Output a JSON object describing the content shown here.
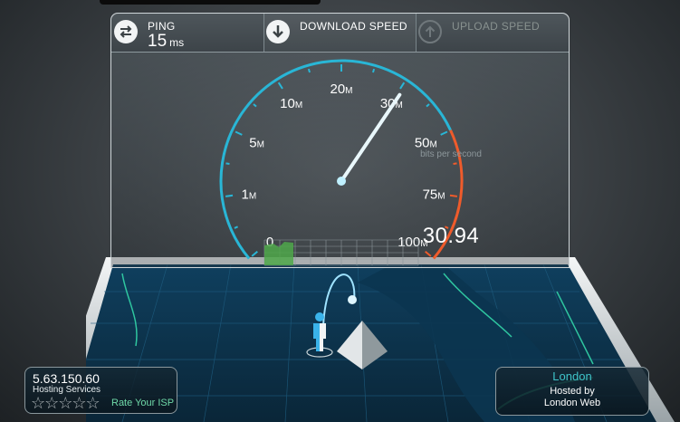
{
  "header": {
    "ping_label": "PING",
    "ping_value": "15",
    "ping_unit": "ms",
    "download_label": "DOWNLOAD SPEED",
    "upload_label": "UPLOAD SPEED"
  },
  "gauge": {
    "ticks": [
      {
        "label": "0",
        "unit": ""
      },
      {
        "label": "1",
        "unit": "M"
      },
      {
        "label": "5",
        "unit": "M"
      },
      {
        "label": "10",
        "unit": "M"
      },
      {
        "label": "20",
        "unit": "M"
      },
      {
        "label": "30",
        "unit": "M"
      },
      {
        "label": "50",
        "unit": "M"
      },
      {
        "label": "75",
        "unit": "M"
      },
      {
        "label": "100",
        "unit": "M"
      }
    ],
    "center_label": "bits per second",
    "speed_value": "30.94",
    "needle_value_mbps": 30.94,
    "accent_color": "#29b6d6",
    "high_color": "#ef5b2b"
  },
  "client": {
    "ip": "5.63.150.60",
    "isp": "Hosting Services",
    "rating_stars": 5,
    "rate_link": "Rate Your ISP"
  },
  "server": {
    "city": "London",
    "hosted_by": "Hosted by",
    "host_name": "London Web"
  },
  "icons": {
    "ping": "swap-arrows-icon",
    "download": "download-arrow-icon",
    "upload": "upload-arrow-icon",
    "user": "person-icon",
    "server": "pyramid-server-icon"
  }
}
